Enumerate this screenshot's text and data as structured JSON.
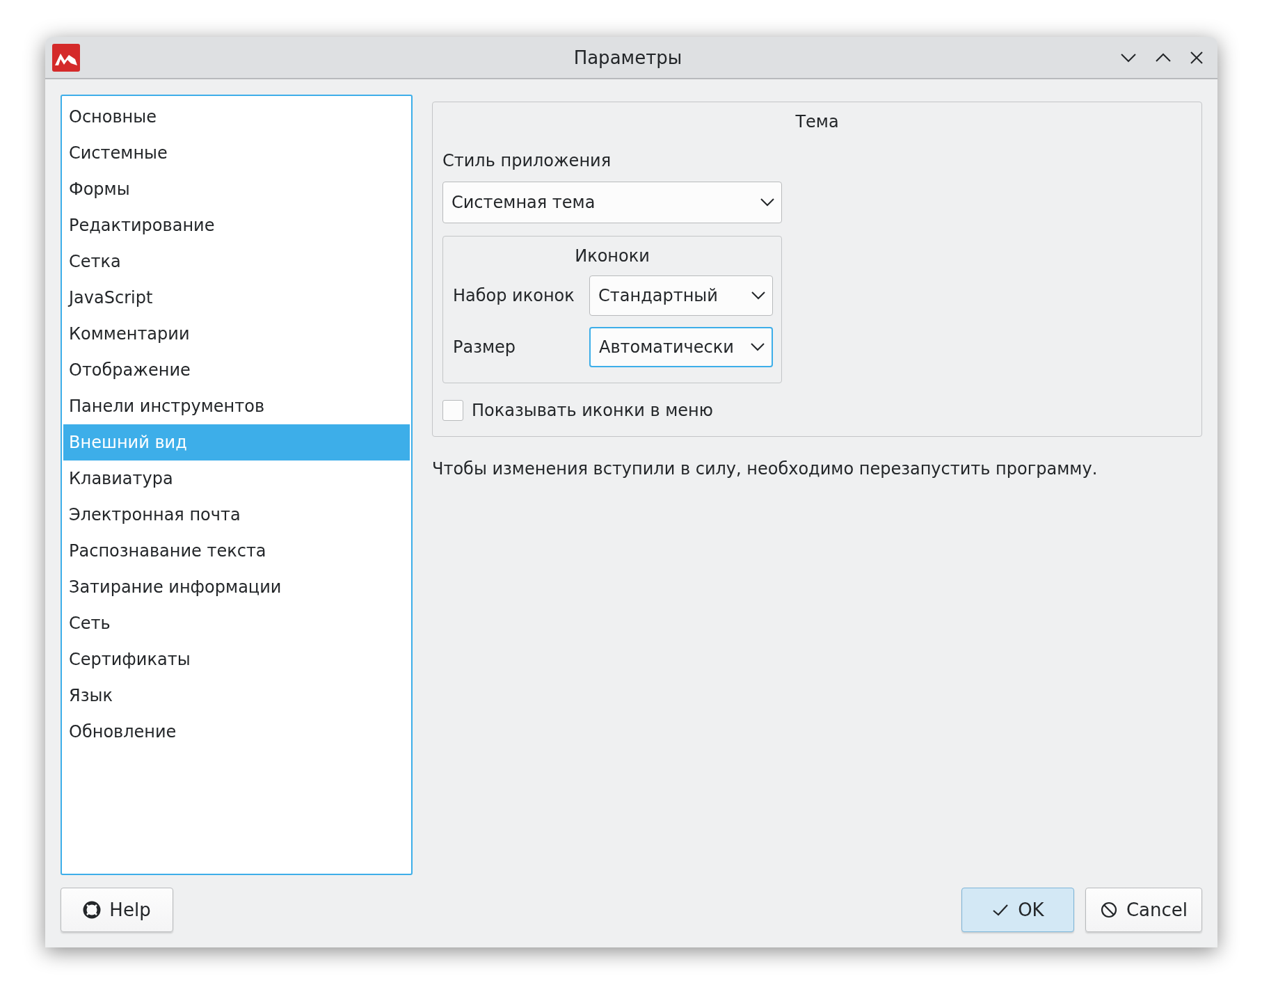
{
  "window": {
    "title": "Параметры"
  },
  "sidebar": {
    "items": [
      {
        "label": "Основные",
        "selected": false
      },
      {
        "label": "Системные",
        "selected": false
      },
      {
        "label": "Формы",
        "selected": false
      },
      {
        "label": "Редактирование",
        "selected": false
      },
      {
        "label": "Сетка",
        "selected": false
      },
      {
        "label": "JavaScript",
        "selected": false
      },
      {
        "label": "Комментарии",
        "selected": false
      },
      {
        "label": "Отображение",
        "selected": false
      },
      {
        "label": "Панели инструментов",
        "selected": false
      },
      {
        "label": "Внешний вид",
        "selected": true
      },
      {
        "label": "Клавиатура",
        "selected": false
      },
      {
        "label": "Электронная почта",
        "selected": false
      },
      {
        "label": "Распознавание текста",
        "selected": false
      },
      {
        "label": "Затирание информации",
        "selected": false
      },
      {
        "label": "Сеть",
        "selected": false
      },
      {
        "label": "Сертификаты",
        "selected": false
      },
      {
        "label": "Язык",
        "selected": false
      },
      {
        "label": "Обновление",
        "selected": false
      }
    ]
  },
  "theme": {
    "title": "Тема",
    "style_label": "Стиль приложения",
    "style_value": "Системная тема",
    "icons": {
      "title": "Иконоки",
      "rows": [
        {
          "label": "Набор иконок",
          "value": "Стандартный",
          "focused": false
        },
        {
          "label": "Размер",
          "value": "Автоматически",
          "focused": true
        }
      ]
    },
    "show_icons": {
      "label": "Показывать иконки в меню",
      "checked": false
    }
  },
  "note": "Чтобы изменения вступили в силу, необходимо перезапустить программу.",
  "buttons": [
    {
      "kind": "help",
      "label": "Help",
      "default": false
    },
    {
      "kind": "ok",
      "label": "OK",
      "default": true
    },
    {
      "kind": "cancel",
      "label": "Cancel",
      "default": false
    }
  ]
}
